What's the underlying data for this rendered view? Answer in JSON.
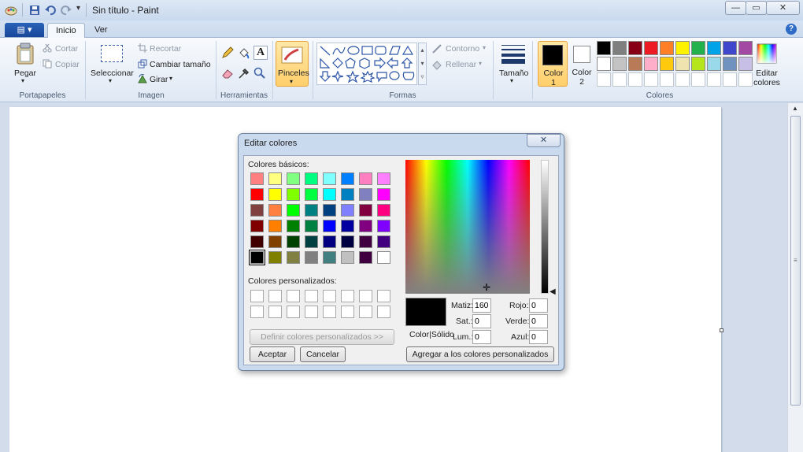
{
  "window": {
    "title": "Sin título - Paint",
    "minimize": "—",
    "maximize": "▭",
    "close": "✕"
  },
  "tabs": {
    "file": "▤ ▾",
    "home": "Inicio",
    "view": "Ver"
  },
  "help": "?",
  "clipboard": {
    "paste": "Pegar",
    "cut": "Cortar",
    "copy": "Copiar",
    "group": "Portapapeles"
  },
  "image": {
    "select": "Seleccionar",
    "crop": "Recortar",
    "resize": "Cambiar tamaño",
    "rotate": "Girar",
    "group": "Imagen"
  },
  "tools": {
    "group": "Herramientas",
    "text_tool": "A"
  },
  "brushes": {
    "label": "Pinceles"
  },
  "shapes": {
    "group": "Formas",
    "outline": "Contorno",
    "fill": "Rellenar"
  },
  "size": {
    "label": "Tamaño"
  },
  "colors": {
    "color1": "Color 1",
    "color2": "Color 2",
    "edit": "Editar colores",
    "group": "Colores",
    "color1_value": "#000000",
    "color2_value": "#ffffff",
    "palette_row1": [
      "#000000",
      "#7f7f7f",
      "#880015",
      "#ed1c24",
      "#ff7f27",
      "#fff200",
      "#22b14c",
      "#00a2e8",
      "#3f48cc",
      "#a349a4"
    ],
    "palette_row2": [
      "#ffffff",
      "#c3c3c3",
      "#b97a57",
      "#ffaec9",
      "#ffc90e",
      "#efe4b0",
      "#b5e61d",
      "#99d9ea",
      "#7092be",
      "#c8bfe7"
    ]
  },
  "dialog": {
    "title": "Editar colores",
    "close": "✕",
    "basic_label": "Colores básicos:",
    "custom_label": "Colores personalizados:",
    "define_btn": "Definir colores personalizados >>",
    "ok": "Aceptar",
    "cancel": "Cancelar",
    "add_btn": "Agregar a los colores personalizados",
    "color_solid": "Color|Sólido",
    "hue_label": "Matiz:",
    "hue": "160",
    "sat_label": "Sat.:",
    "sat": "0",
    "lum_label": "Lum.:",
    "lum": "0",
    "red_label": "Rojo:",
    "red": "0",
    "green_label": "Verde:",
    "green": "0",
    "blue_label": "Azul:",
    "blue": "0",
    "basic_colors": [
      [
        "#ff8080",
        "#ffff80",
        "#80ff80",
        "#00ff80",
        "#80ffff",
        "#0080ff",
        "#ff80c0",
        "#ff80ff"
      ],
      [
        "#ff0000",
        "#ffff00",
        "#80ff00",
        "#00ff40",
        "#00ffff",
        "#0080c0",
        "#8080c0",
        "#ff00ff"
      ],
      [
        "#804040",
        "#ff8040",
        "#00ff00",
        "#008080",
        "#004080",
        "#8080ff",
        "#800040",
        "#ff0080"
      ],
      [
        "#800000",
        "#ff8000",
        "#008000",
        "#008040",
        "#0000ff",
        "#0000a0",
        "#800080",
        "#8000ff"
      ],
      [
        "#400000",
        "#804000",
        "#004000",
        "#004040",
        "#000080",
        "#000040",
        "#400040",
        "#400080"
      ],
      [
        "#000000",
        "#808000",
        "#808040",
        "#808080",
        "#408080",
        "#c0c0c0",
        "#400040",
        "#ffffff"
      ]
    ],
    "selected_color": "#000000"
  }
}
